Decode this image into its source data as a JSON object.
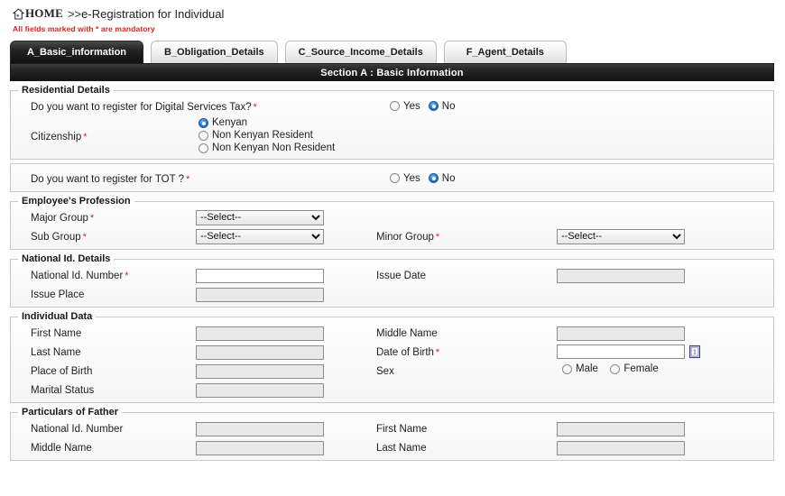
{
  "breadcrumb": {
    "home_label": "HOME",
    "separator": ">>",
    "title": "e-Registration for Individual",
    "home_icon": "home-icon"
  },
  "mandatory_note": "All fields marked with * are mandatory",
  "tabs": [
    {
      "label": "A_Basic_information",
      "active": true
    },
    {
      "label": "B_Obligation_Details",
      "active": false
    },
    {
      "label": "C_Source_Income_Details",
      "active": false
    },
    {
      "label": "F_Agent_Details",
      "active": false
    }
  ],
  "section_bar": "Section A : Basic Information",
  "colors": {
    "mandatory_red": "#e2211c",
    "radio_selected_blue": "#1f74c9",
    "section_bar_dark": "#131313",
    "tab_active_dark": "#232323"
  },
  "residential": {
    "legend": "Residential Details",
    "dst_question": "Do you want to register for Digital Services Tax?",
    "dst_yes": "Yes",
    "dst_no": "No",
    "dst_selected": "No",
    "citizenship_label": "Citizenship",
    "citizenship_options": [
      "Kenyan",
      "Non Kenyan Resident",
      "Non Kenyan Non Resident"
    ],
    "citizenship_selected": "Kenyan"
  },
  "tot": {
    "question": "Do you want to register for TOT ?",
    "yes": "Yes",
    "no": "No",
    "selected": "No"
  },
  "profession": {
    "legend": "Employee's Profession",
    "major_group_label": "Major Group",
    "major_group_value": "--Select--",
    "sub_group_label": "Sub Group",
    "sub_group_value": "--Select--",
    "minor_group_label": "Minor Group",
    "minor_group_value": "--Select--"
  },
  "national_id": {
    "legend": "National Id. Details",
    "number_label": "National Id. Number",
    "number_value": "",
    "issue_date_label": "Issue Date",
    "issue_date_value": "",
    "issue_place_label": "Issue Place",
    "issue_place_value": ""
  },
  "individual": {
    "legend": "Individual Data",
    "first_name_label": "First Name",
    "first_name_value": "",
    "middle_name_label": "Middle Name",
    "middle_name_value": "",
    "last_name_label": "Last Name",
    "last_name_value": "",
    "dob_label": "Date of Birth",
    "dob_value": "",
    "dob_icon": "calendar-icon",
    "place_of_birth_label": "Place of Birth",
    "place_of_birth_value": "",
    "sex_label": "Sex",
    "sex_male": "Male",
    "sex_female": "Female",
    "sex_selected": "",
    "marital_status_label": "Marital Status",
    "marital_status_value": ""
  },
  "father": {
    "legend": "Particulars of Father",
    "national_id_label": "National Id. Number",
    "national_id_value": "",
    "first_name_label": "First Name",
    "first_name_value": "",
    "middle_name_label": "Middle Name",
    "middle_name_value": "",
    "last_name_label": "Last Name",
    "last_name_value": ""
  }
}
